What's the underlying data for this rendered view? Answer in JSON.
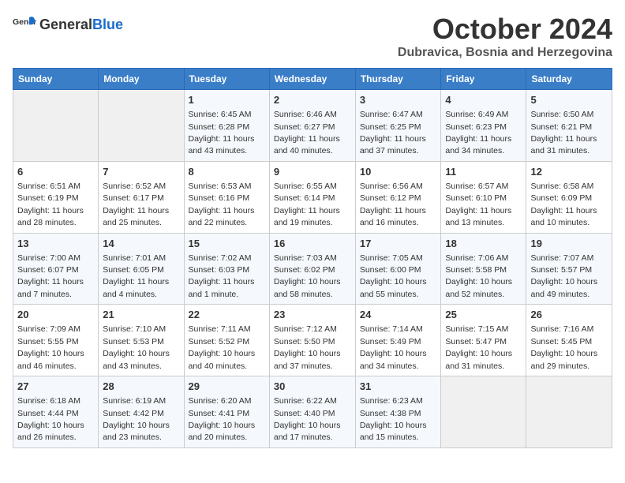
{
  "logo": {
    "text_general": "General",
    "text_blue": "Blue"
  },
  "header": {
    "month_year": "October 2024",
    "location": "Dubravica, Bosnia and Herzegovina"
  },
  "weekdays": [
    "Sunday",
    "Monday",
    "Tuesday",
    "Wednesday",
    "Thursday",
    "Friday",
    "Saturday"
  ],
  "weeks": [
    [
      {
        "day": "",
        "sunrise": "",
        "sunset": "",
        "daylight": "",
        "empty": true
      },
      {
        "day": "",
        "sunrise": "",
        "sunset": "",
        "daylight": "",
        "empty": true
      },
      {
        "day": "1",
        "sunrise": "Sunrise: 6:45 AM",
        "sunset": "Sunset: 6:28 PM",
        "daylight": "Daylight: 11 hours and 43 minutes."
      },
      {
        "day": "2",
        "sunrise": "Sunrise: 6:46 AM",
        "sunset": "Sunset: 6:27 PM",
        "daylight": "Daylight: 11 hours and 40 minutes."
      },
      {
        "day": "3",
        "sunrise": "Sunrise: 6:47 AM",
        "sunset": "Sunset: 6:25 PM",
        "daylight": "Daylight: 11 hours and 37 minutes."
      },
      {
        "day": "4",
        "sunrise": "Sunrise: 6:49 AM",
        "sunset": "Sunset: 6:23 PM",
        "daylight": "Daylight: 11 hours and 34 minutes."
      },
      {
        "day": "5",
        "sunrise": "Sunrise: 6:50 AM",
        "sunset": "Sunset: 6:21 PM",
        "daylight": "Daylight: 11 hours and 31 minutes."
      }
    ],
    [
      {
        "day": "6",
        "sunrise": "Sunrise: 6:51 AM",
        "sunset": "Sunset: 6:19 PM",
        "daylight": "Daylight: 11 hours and 28 minutes."
      },
      {
        "day": "7",
        "sunrise": "Sunrise: 6:52 AM",
        "sunset": "Sunset: 6:17 PM",
        "daylight": "Daylight: 11 hours and 25 minutes."
      },
      {
        "day": "8",
        "sunrise": "Sunrise: 6:53 AM",
        "sunset": "Sunset: 6:16 PM",
        "daylight": "Daylight: 11 hours and 22 minutes."
      },
      {
        "day": "9",
        "sunrise": "Sunrise: 6:55 AM",
        "sunset": "Sunset: 6:14 PM",
        "daylight": "Daylight: 11 hours and 19 minutes."
      },
      {
        "day": "10",
        "sunrise": "Sunrise: 6:56 AM",
        "sunset": "Sunset: 6:12 PM",
        "daylight": "Daylight: 11 hours and 16 minutes."
      },
      {
        "day": "11",
        "sunrise": "Sunrise: 6:57 AM",
        "sunset": "Sunset: 6:10 PM",
        "daylight": "Daylight: 11 hours and 13 minutes."
      },
      {
        "day": "12",
        "sunrise": "Sunrise: 6:58 AM",
        "sunset": "Sunset: 6:09 PM",
        "daylight": "Daylight: 11 hours and 10 minutes."
      }
    ],
    [
      {
        "day": "13",
        "sunrise": "Sunrise: 7:00 AM",
        "sunset": "Sunset: 6:07 PM",
        "daylight": "Daylight: 11 hours and 7 minutes."
      },
      {
        "day": "14",
        "sunrise": "Sunrise: 7:01 AM",
        "sunset": "Sunset: 6:05 PM",
        "daylight": "Daylight: 11 hours and 4 minutes."
      },
      {
        "day": "15",
        "sunrise": "Sunrise: 7:02 AM",
        "sunset": "Sunset: 6:03 PM",
        "daylight": "Daylight: 11 hours and 1 minute."
      },
      {
        "day": "16",
        "sunrise": "Sunrise: 7:03 AM",
        "sunset": "Sunset: 6:02 PM",
        "daylight": "Daylight: 10 hours and 58 minutes."
      },
      {
        "day": "17",
        "sunrise": "Sunrise: 7:05 AM",
        "sunset": "Sunset: 6:00 PM",
        "daylight": "Daylight: 10 hours and 55 minutes."
      },
      {
        "day": "18",
        "sunrise": "Sunrise: 7:06 AM",
        "sunset": "Sunset: 5:58 PM",
        "daylight": "Daylight: 10 hours and 52 minutes."
      },
      {
        "day": "19",
        "sunrise": "Sunrise: 7:07 AM",
        "sunset": "Sunset: 5:57 PM",
        "daylight": "Daylight: 10 hours and 49 minutes."
      }
    ],
    [
      {
        "day": "20",
        "sunrise": "Sunrise: 7:09 AM",
        "sunset": "Sunset: 5:55 PM",
        "daylight": "Daylight: 10 hours and 46 minutes."
      },
      {
        "day": "21",
        "sunrise": "Sunrise: 7:10 AM",
        "sunset": "Sunset: 5:53 PM",
        "daylight": "Daylight: 10 hours and 43 minutes."
      },
      {
        "day": "22",
        "sunrise": "Sunrise: 7:11 AM",
        "sunset": "Sunset: 5:52 PM",
        "daylight": "Daylight: 10 hours and 40 minutes."
      },
      {
        "day": "23",
        "sunrise": "Sunrise: 7:12 AM",
        "sunset": "Sunset: 5:50 PM",
        "daylight": "Daylight: 10 hours and 37 minutes."
      },
      {
        "day": "24",
        "sunrise": "Sunrise: 7:14 AM",
        "sunset": "Sunset: 5:49 PM",
        "daylight": "Daylight: 10 hours and 34 minutes."
      },
      {
        "day": "25",
        "sunrise": "Sunrise: 7:15 AM",
        "sunset": "Sunset: 5:47 PM",
        "daylight": "Daylight: 10 hours and 31 minutes."
      },
      {
        "day": "26",
        "sunrise": "Sunrise: 7:16 AM",
        "sunset": "Sunset: 5:45 PM",
        "daylight": "Daylight: 10 hours and 29 minutes."
      }
    ],
    [
      {
        "day": "27",
        "sunrise": "Sunrise: 6:18 AM",
        "sunset": "Sunset: 4:44 PM",
        "daylight": "Daylight: 10 hours and 26 minutes."
      },
      {
        "day": "28",
        "sunrise": "Sunrise: 6:19 AM",
        "sunset": "Sunset: 4:42 PM",
        "daylight": "Daylight: 10 hours and 23 minutes."
      },
      {
        "day": "29",
        "sunrise": "Sunrise: 6:20 AM",
        "sunset": "Sunset: 4:41 PM",
        "daylight": "Daylight: 10 hours and 20 minutes."
      },
      {
        "day": "30",
        "sunrise": "Sunrise: 6:22 AM",
        "sunset": "Sunset: 4:40 PM",
        "daylight": "Daylight: 10 hours and 17 minutes."
      },
      {
        "day": "31",
        "sunrise": "Sunrise: 6:23 AM",
        "sunset": "Sunset: 4:38 PM",
        "daylight": "Daylight: 10 hours and 15 minutes."
      },
      {
        "day": "",
        "sunrise": "",
        "sunset": "",
        "daylight": "",
        "empty": true
      },
      {
        "day": "",
        "sunrise": "",
        "sunset": "",
        "daylight": "",
        "empty": true
      }
    ]
  ]
}
